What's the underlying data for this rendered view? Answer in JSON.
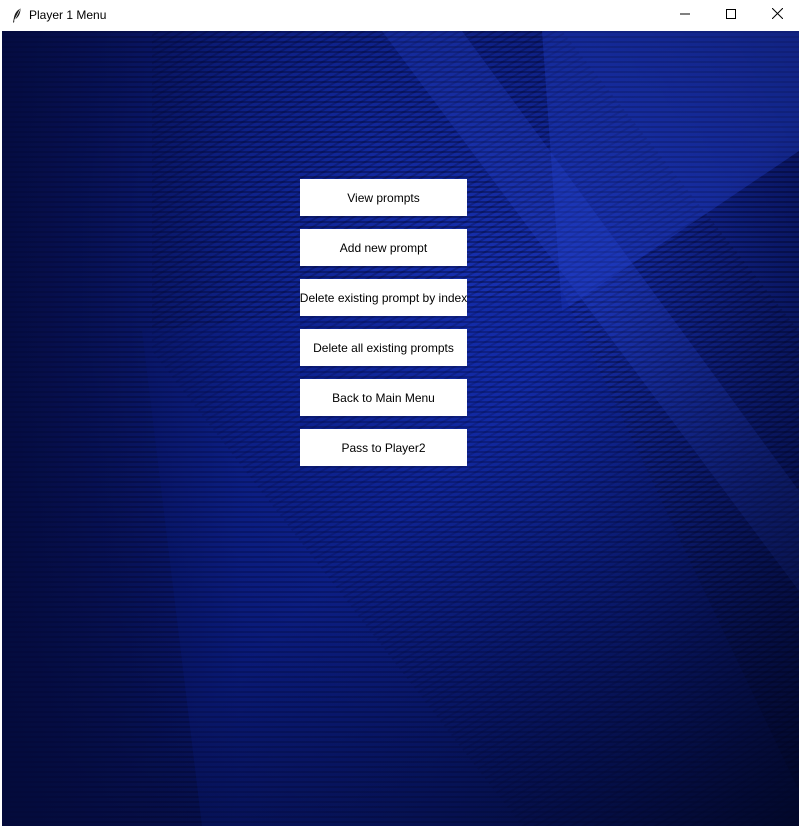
{
  "window": {
    "title": "Player 1 Menu",
    "app_icon": "feather-icon",
    "controls": [
      "minimize-icon",
      "maximize-icon",
      "close-icon"
    ]
  },
  "background": {
    "description_colors": [
      "#050d40",
      "#0a1a78",
      "#122aa6",
      "#1c3ad0"
    ]
  },
  "menu": {
    "buttons": [
      {
        "label": "View prompts"
      },
      {
        "label": "Add new prompt"
      },
      {
        "label": "Delete existing prompt by index"
      },
      {
        "label": "Delete all existing prompts"
      },
      {
        "label": "Back to Main Menu"
      },
      {
        "label": "Pass to Player2"
      }
    ]
  }
}
